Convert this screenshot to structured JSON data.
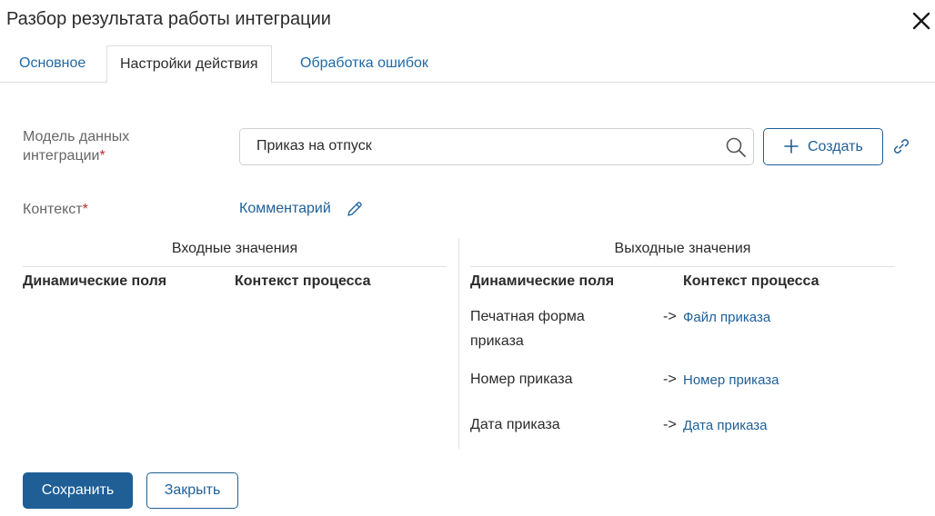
{
  "dialog": {
    "title": "Разбор результата работы интеграции",
    "close_icon": "close-icon"
  },
  "tabs": [
    {
      "label": "Основное",
      "active": false
    },
    {
      "label": "Настройки действия",
      "active": true
    },
    {
      "label": "Обработка ошибок",
      "active": false
    }
  ],
  "form": {
    "model_label_line1": "Модель данных",
    "model_label_line2": "интеграции",
    "required_mark": "*",
    "model_value": "Приказ на отпуск",
    "search_icon": "search-icon",
    "create_label": "Создать",
    "plus_icon": "plus-icon",
    "link_icon": "link-icon",
    "context_label": "Контекст",
    "context_value": "Комментарий",
    "pencil_icon": "pencil-icon"
  },
  "inputs": {
    "title": "Входные значения",
    "col_dynamic": "Динамические поля",
    "col_context": "Контекст процесса"
  },
  "outputs": {
    "title": "Выходные значения",
    "col_dynamic": "Динамические поля",
    "col_context": "Контекст процесса",
    "rows": [
      {
        "name": "Печатная форма приказа",
        "arrow": "->",
        "target": "Файл приказа"
      },
      {
        "name": "Номер приказа",
        "arrow": "->",
        "target": "Номер приказа"
      },
      {
        "name": "Дата приказа",
        "arrow": "->",
        "target": "Дата приказа"
      }
    ]
  },
  "footer": {
    "save_label": "Сохранить",
    "close_label": "Закрыть"
  },
  "colors": {
    "primary": "#1f5f96",
    "tab_link": "#1f6aa8",
    "required": "#c62828"
  }
}
